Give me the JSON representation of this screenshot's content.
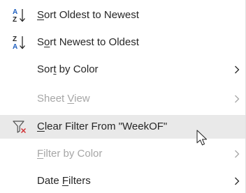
{
  "menu": {
    "items": [
      {
        "pre": "",
        "key": "S",
        "post": "ort Oldest to Newest",
        "icon": "sort-ascending-az-icon",
        "submenu": false,
        "disabled": false,
        "hover": false
      },
      {
        "pre": "S",
        "key": "o",
        "post": "rt Newest to Oldest",
        "icon": "sort-descending-za-icon",
        "submenu": false,
        "disabled": false,
        "hover": false
      },
      {
        "pre": "Sor",
        "key": "t",
        "post": " by Color",
        "icon": "",
        "submenu": true,
        "disabled": false,
        "hover": false
      },
      {
        "pre": "Sheet ",
        "key": "V",
        "post": "iew",
        "icon": "",
        "submenu": true,
        "disabled": true,
        "hover": false
      },
      {
        "pre": "",
        "key": "C",
        "post": "lear Filter From \"WeekOF\"",
        "icon": "clear-filter-icon",
        "submenu": false,
        "disabled": false,
        "hover": true
      },
      {
        "pre": "",
        "key": "F",
        "post": "ilter by Color",
        "icon": "",
        "submenu": true,
        "disabled": true,
        "hover": false
      },
      {
        "pre": "Date ",
        "key": "F",
        "post": "ilters",
        "icon": "",
        "submenu": true,
        "disabled": false,
        "hover": false
      }
    ]
  },
  "colors": {
    "text": "#262626",
    "disabled_text": "#a6a6a6",
    "hover_background": "#e9e9e9",
    "sort_icon_blue": "#1f5fbf",
    "clear_filter_red": "#d13438"
  }
}
